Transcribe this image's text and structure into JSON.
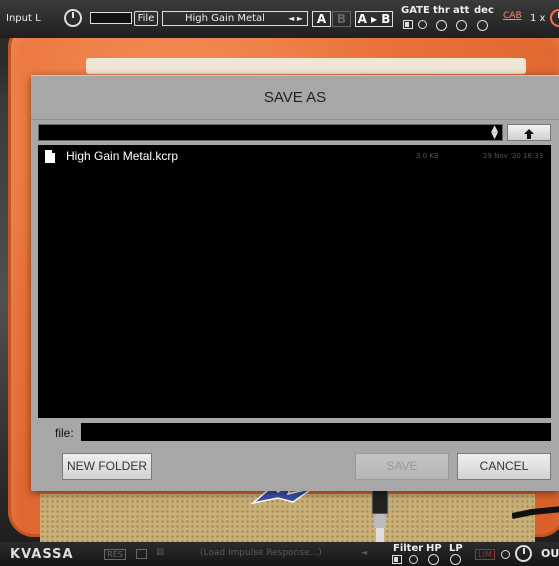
{
  "toolbar": {
    "input_label": "Input L",
    "file_label": "File",
    "preset_name": "High Gain Metal",
    "preset_arrows": "◄ ►",
    "a_label": "A",
    "b_label": "B",
    "atob_label": "A ▸ B",
    "gate_label": "GATE",
    "thr_label": "thr",
    "att_label": "att",
    "dec_label": "dec",
    "cab_label": "CAB",
    "oversample_label": "1 x"
  },
  "dialog": {
    "title": "SAVE AS",
    "up_icon": "up-arrow-icon",
    "files": [
      {
        "name": "High Gain Metal.kcrp",
        "size": "3.0 KB",
        "date": "29 Nov '20 16:33"
      }
    ],
    "file_label": "file:",
    "file_value": "",
    "new_folder_label": "NEW FOLDER",
    "save_label": "SAVE",
    "cancel_label": "CANCEL"
  },
  "bottombar": {
    "brand": "KVASSA",
    "res_label": "RES",
    "ir_placeholder": "(Load Impulse Response...)",
    "filter_label": "Filter",
    "hp_label": "HP",
    "lp_label": "LP",
    "lim_label": "LIM",
    "out_label": "OU"
  },
  "colors": {
    "amp_orange": "#e8723a",
    "dialog_bg": "#a7a7a7",
    "list_bg": "#000000"
  }
}
